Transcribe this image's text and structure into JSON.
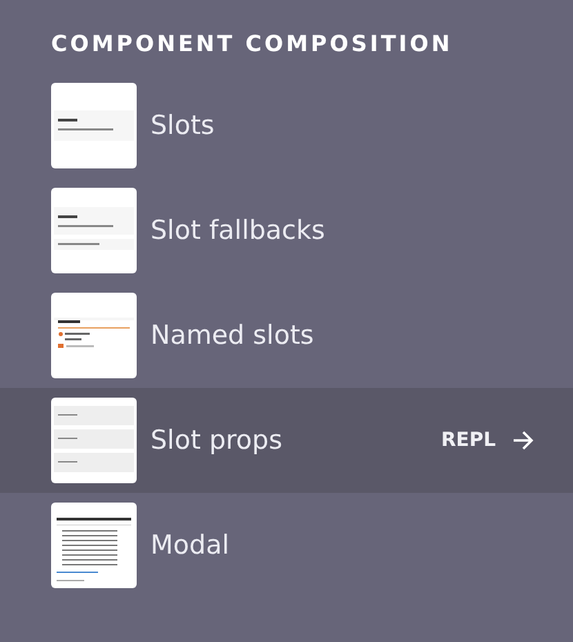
{
  "section": {
    "title": "COMPONENT COMPOSITION"
  },
  "items": [
    {
      "title": "Slots",
      "selected": false,
      "kind": "card"
    },
    {
      "title": "Slot fallbacks",
      "selected": false,
      "kind": "card-footer"
    },
    {
      "title": "Named slots",
      "selected": false,
      "kind": "profile"
    },
    {
      "title": "Slot props",
      "selected": true,
      "kind": "rows"
    },
    {
      "title": "Modal",
      "selected": false,
      "kind": "list"
    }
  ],
  "repl_link": {
    "label": "REPL"
  }
}
